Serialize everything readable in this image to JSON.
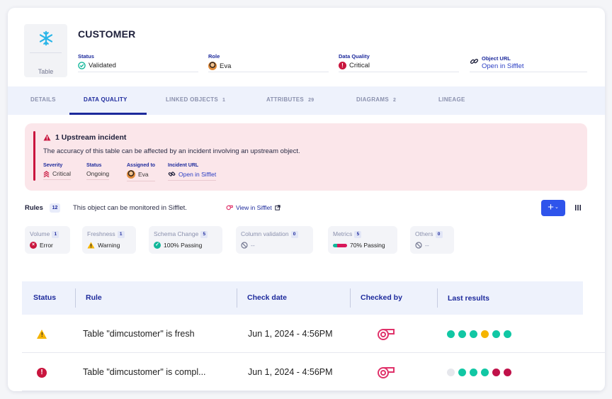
{
  "object": {
    "icon": "snowflake-icon",
    "type_label": "Table",
    "title": "CUSTOMER"
  },
  "meta": {
    "status": {
      "label": "Status",
      "value": "Validated"
    },
    "role": {
      "label": "Role",
      "value": "Eva"
    },
    "data_quality": {
      "label": "Data Quality",
      "value": "Critical"
    },
    "object_url": {
      "label": "Object URL",
      "value": "Open in Sifflet"
    }
  },
  "tabs": [
    {
      "label": "DETAILS",
      "count": ""
    },
    {
      "label": "DATA QUALITY",
      "count": ""
    },
    {
      "label": "LINKED OBJECTS",
      "count": "1"
    },
    {
      "label": "ATTRIBUTES",
      "count": "29"
    },
    {
      "label": "DIAGRAMS",
      "count": "2"
    },
    {
      "label": "LINEAGE",
      "count": ""
    }
  ],
  "active_tab": "DATA QUALITY",
  "incident": {
    "title": "1 Upstream incident",
    "description": "The accuracy of this table can be affected by an incident involving an upstream object.",
    "severity": {
      "label": "Severity",
      "value": "Critical"
    },
    "status": {
      "label": "Status",
      "value": "Ongoing"
    },
    "assigned": {
      "label": "Assigned to",
      "value": "Eva"
    },
    "url": {
      "label": "Incident URL",
      "value": "Open in Sifflet"
    }
  },
  "rules": {
    "label": "Rules",
    "count": "12",
    "message": "This object can be monitored in Sifflet.",
    "view_link": "View in Sifflet",
    "add_label": "+"
  },
  "chips": [
    {
      "label": "Volume",
      "count": "1",
      "value": "Error"
    },
    {
      "label": "Freshness",
      "count": "1",
      "value": "Warning"
    },
    {
      "label": "Schema Change",
      "count": "5",
      "value": "100% Passing"
    },
    {
      "label": "Column validation",
      "count": "0",
      "value": "--"
    },
    {
      "label": "Metrics",
      "count": "5",
      "value": "70% Passing"
    },
    {
      "label": "Others",
      "count": "0",
      "value": "--"
    }
  ],
  "table": {
    "headers": [
      "Status",
      "Rule",
      "Check date",
      "Checked by",
      "Last results"
    ],
    "rows": [
      {
        "status": "warning",
        "rule": "Table \"dimcustomer\" is fresh",
        "date": "Jun 1, 2024 - 4:56PM",
        "checked_by": "sifflet-logo-icon",
        "results": [
          "#11c7a4",
          "#11c7a4",
          "#11c7a4",
          "#f5b400",
          "#11c7a4",
          "#11c7a4"
        ]
      },
      {
        "status": "error",
        "rule": "Table \"dimcustomer\" is compl...",
        "date": "Jun 1, 2024 - 4:56PM",
        "checked_by": "sifflet-logo-icon",
        "results": [
          "#e6e7ec",
          "#11c7a4",
          "#11c7a4",
          "#11c7a4",
          "#c0124a",
          "#c0124a"
        ]
      }
    ]
  }
}
